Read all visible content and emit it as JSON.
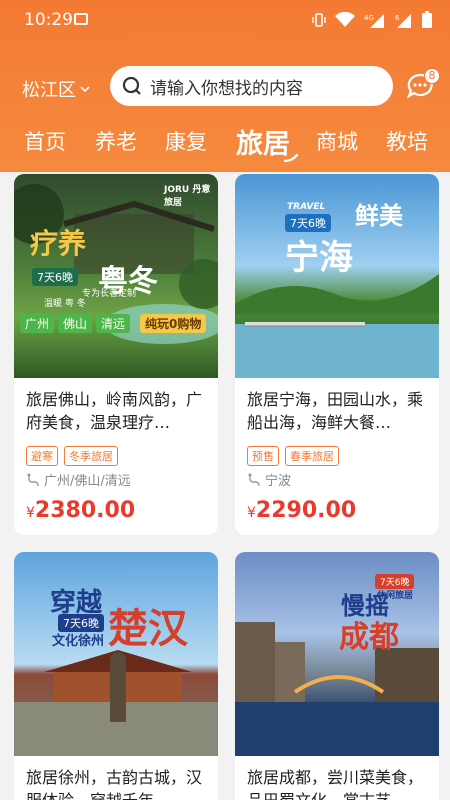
{
  "status": {
    "time": "10:29",
    "network": "4G",
    "sim": "6"
  },
  "location": {
    "district": "松江区"
  },
  "search": {
    "placeholder": "请输入你想找的内容"
  },
  "messages": {
    "badge": "8"
  },
  "tabs": [
    {
      "label": "首页"
    },
    {
      "label": "养老"
    },
    {
      "label": "康复"
    },
    {
      "label": "旅居"
    },
    {
      "label": "商城"
    },
    {
      "label": "教培"
    }
  ],
  "products": [
    {
      "title": "旅居佛山，岭南风韵，广府美食，温泉理疗…",
      "tags": [
        "避寒",
        "冬季旅居"
      ],
      "location": "广州/佛山/清远",
      "currency": "¥",
      "price": "2380.00",
      "image": {
        "brand": "JORU 丹意旅居",
        "main1": "疗养",
        "main2": "粤冬",
        "days": "7天6晚",
        "sub1": "专为长者定制",
        "sub2": "温暖 粤 冬",
        "chips": [
          "广州",
          "佛山",
          "清远"
        ],
        "promo": "纯玩0购物"
      }
    },
    {
      "title": "旅居宁海，田园山水，乘船出海，海鲜大餐…",
      "tags": [
        "预售",
        "春季旅居"
      ],
      "location": "宁波",
      "currency": "¥",
      "price": "2290.00",
      "image": {
        "en": "TRAVEL",
        "main1": "鲜美",
        "main2": "宁海",
        "days": "7天6晚"
      }
    },
    {
      "title": "旅居徐州，古韵古城，汉服体验，穿越千年…",
      "image": {
        "main1": "穿越",
        "main2": "楚汉",
        "days": "7天6晚",
        "sub": "文化徐州"
      }
    },
    {
      "title": "旅居成都，尝川菜美食，品巴蜀文化，赏古艺…",
      "image": {
        "main1": "慢摇",
        "main2": "成都",
        "days": "7天6晚",
        "sub": "休闲旅居"
      }
    }
  ]
}
